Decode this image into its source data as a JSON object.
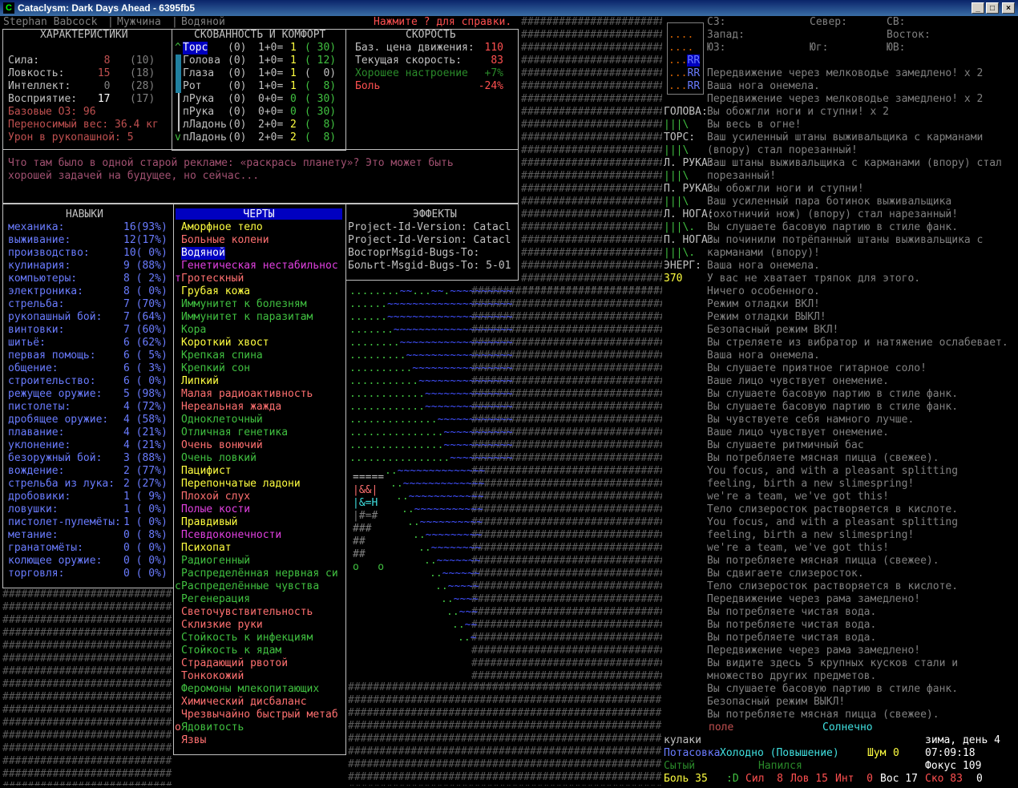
{
  "window": {
    "title": "Cataclysm: Dark Days Ahead - 6395fb5",
    "app_icon": "C",
    "min": "_",
    "max": "□",
    "close": "×"
  },
  "header": {
    "name": "Stephan Babcock",
    "sep1": "|",
    "gender": "Мужчина",
    "sep2": "|",
    "profession": "Водяной",
    "help": "Нажмите ? для справки."
  },
  "stats": {
    "title": "ХАРАКТЕРИСТИКИ",
    "rows": [
      {
        "label": "Сила:",
        "val": "8",
        "base": "(10)"
      },
      {
        "label": "Ловкость:",
        "val": "15",
        "base": "(18)"
      },
      {
        "label": "Интеллект:",
        "val": "0",
        "base": "(28)"
      },
      {
        "label": "Восприятие:",
        "val": "17",
        "base": "(17)"
      }
    ],
    "base_hp": "Базовые ОЗ: 96",
    "carry": "Переносимый вес: 36.4 кг",
    "unarmed": "Урон в рукопашной: 5"
  },
  "encumbrance": {
    "title": "СКОВАННОСТЬ И КОМФОРТ",
    "up_arrow": "^",
    "down_arrow": "v",
    "rows": [
      {
        "part": "Торс",
        "a": "(0)",
        "calc": "1+0=",
        "val": "1",
        "warm": "( 30)"
      },
      {
        "part": "Голова",
        "a": "(0)",
        "calc": "1+0=",
        "val": "1",
        "warm": "( 12)"
      },
      {
        "part": "Глаза",
        "a": "(0)",
        "calc": "1+0=",
        "val": "1",
        "warm": "(  0)"
      },
      {
        "part": "Рот",
        "a": "(0)",
        "calc": "1+0=",
        "val": "1",
        "warm": "(  8)"
      },
      {
        "part": "лРука",
        "a": "(0)",
        "calc": "0+0=",
        "val": "0",
        "warm": "( 30)"
      },
      {
        "part": "пРука",
        "a": "(0)",
        "calc": "0+0=",
        "val": "0",
        "warm": "( 30)"
      },
      {
        "part": "лЛадонь",
        "a": "(0)",
        "calc": "2+0=",
        "val": "2",
        "warm": "(  8)"
      },
      {
        "part": "пЛадонь",
        "a": "(0)",
        "calc": "2+0=",
        "val": "2",
        "warm": "(  8)"
      }
    ]
  },
  "speed": {
    "title": "СКОРОСТЬ",
    "rows": [
      {
        "label": "Баз. цена движения:",
        "val": "110"
      },
      {
        "label": "Текущая скорость:",
        "val": "83"
      },
      {
        "label": "Хорошее настроение",
        "val": "+7%"
      },
      {
        "label": "Боль",
        "val": "-24%"
      }
    ]
  },
  "description": {
    "line1": "Что там было в одной старой рекламе: «раскрась планету»? Это может быть",
    "line2": "хорошей задачей на будущее, но сейчас..."
  },
  "skills": {
    "title": "НАВЫКИ",
    "rows": [
      {
        "n": "механика:",
        "v": "16(93%)"
      },
      {
        "n": "выживание:",
        "v": "12(17%)"
      },
      {
        "n": "производство:",
        "v": "10( 0%)"
      },
      {
        "n": "кулинария:",
        "v": "9 (88%)"
      },
      {
        "n": "компьютеры:",
        "v": "8 ( 2%)"
      },
      {
        "n": "электроника:",
        "v": "8 ( 0%)"
      },
      {
        "n": "стрельба:",
        "v": "7 (70%)"
      },
      {
        "n": "рукопашный бой:",
        "v": "7 (64%)"
      },
      {
        "n": "винтовки:",
        "v": "7 (60%)"
      },
      {
        "n": "шитьё:",
        "v": "6 (62%)"
      },
      {
        "n": "первая помощь:",
        "v": "6 ( 5%)"
      },
      {
        "n": "общение:",
        "v": "6 ( 3%)"
      },
      {
        "n": "строительство:",
        "v": "6 ( 0%)"
      },
      {
        "n": "режущее оружие:",
        "v": "5 (98%)"
      },
      {
        "n": "пистолеты:",
        "v": "4 (72%)"
      },
      {
        "n": "дробящее оружие:",
        "v": "4 (58%)"
      },
      {
        "n": "плавание:",
        "v": "4 (21%)"
      },
      {
        "n": "уклонение:",
        "v": "4 (21%)"
      },
      {
        "n": "безоружный бой:",
        "v": "3 (88%)"
      },
      {
        "n": "вождение:",
        "v": "2 (77%)"
      },
      {
        "n": "стрельба из лука:",
        "v": "2 (27%)"
      },
      {
        "n": "дробовики:",
        "v": "1 ( 9%)"
      },
      {
        "n": "ловушки:",
        "v": "1 ( 0%)"
      },
      {
        "n": "пистолет-пулемёты:",
        "v": "1 ( 0%)"
      },
      {
        "n": "метание:",
        "v": "0 ( 8%)"
      },
      {
        "n": "гранатомёты:",
        "v": "0 ( 0%)"
      },
      {
        "n": "колющее оружие:",
        "v": "0 ( 0%)"
      },
      {
        "n": "торговля:",
        "v": "0 ( 0%)"
      }
    ]
  },
  "traits": {
    "title": "ЧЕРТЫ",
    "markers": {
      "t": "т",
      "c": "c",
      "o": "o"
    },
    "rows": [
      {
        "t": "Аморфное тело",
        "c": "#ffff40"
      },
      {
        "t": "Больные колени",
        "c": "#ff7070"
      },
      {
        "t": "Водяной",
        "c": "#ffffff"
      },
      {
        "t": "Генетическая нестабильнос",
        "c": "#e040e0"
      },
      {
        "t": "Гротескный",
        "c": "#ff7070"
      },
      {
        "t": "Грубая кожа",
        "c": "#ffff40"
      },
      {
        "t": "Иммунитет к болезням",
        "c": "#40c040"
      },
      {
        "t": "Иммунитет к паразитам",
        "c": "#40c040"
      },
      {
        "t": "Кора",
        "c": "#40c040"
      },
      {
        "t": "Короткий хвост",
        "c": "#ffff40"
      },
      {
        "t": "Крепкая спина",
        "c": "#40c040"
      },
      {
        "t": "Крепкий сон",
        "c": "#40c040"
      },
      {
        "t": "Липкий",
        "c": "#ffff40"
      },
      {
        "t": "Малая радиоактивность",
        "c": "#ff7070"
      },
      {
        "t": "Нереальная жажда",
        "c": "#ff7070"
      },
      {
        "t": "Одноклеточный",
        "c": "#40c040"
      },
      {
        "t": "Отличная генетика",
        "c": "#40c040"
      },
      {
        "t": "Очень вонючий",
        "c": "#ff7070"
      },
      {
        "t": "Очень ловкий",
        "c": "#40c040"
      },
      {
        "t": "Пацифист",
        "c": "#ffff40"
      },
      {
        "t": "Перепончатые ладони",
        "c": "#ffff40"
      },
      {
        "t": "Плохой слух",
        "c": "#ff7070"
      },
      {
        "t": "Полые кости",
        "c": "#e040e0"
      },
      {
        "t": "Правдивый",
        "c": "#ffff40"
      },
      {
        "t": "Псевдоконечности",
        "c": "#e040e0"
      },
      {
        "t": "Психопат",
        "c": "#ffff40"
      },
      {
        "t": "Радиогенный",
        "c": "#40c040"
      },
      {
        "t": "Распределённая нервная си",
        "c": "#40c040"
      },
      {
        "t": "Распределённые чувства",
        "c": "#40c040"
      },
      {
        "t": "Регенерация",
        "c": "#40c040"
      },
      {
        "t": "Светочувствительность",
        "c": "#ff7070"
      },
      {
        "t": "Склизкие руки",
        "c": "#ff7070"
      },
      {
        "t": "Стойкость к инфекциям",
        "c": "#40c040"
      },
      {
        "t": "Стойкость к ядам",
        "c": "#40c040"
      },
      {
        "t": "Страдающий рвотой",
        "c": "#ff7070"
      },
      {
        "t": "Тонкокожий",
        "c": "#ff7070"
      },
      {
        "t": "Феромоны млекопитающих",
        "c": "#40c040"
      },
      {
        "t": "Химический дисбаланс",
        "c": "#ff7070"
      },
      {
        "t": "Чрезвычайно быстрый метаб",
        "c": "#ff7070"
      },
      {
        "t": "Ядовитость",
        "c": "#40c040"
      },
      {
        "t": "Язвы",
        "c": "#ff7070"
      }
    ]
  },
  "effects": {
    "title": "ЭФФЕКТЫ",
    "rows": [
      "Project-Id-Version: Catacl",
      "Project-Id-Version: Catacl",
      "ВосторгMsgid-Bugs-To:",
      "Больrt-Msgid-Bugs-To: 5-01"
    ]
  },
  "compass": {
    "rows": [
      {
        "a": "СЗ:",
        "b": "Север:",
        "c": "СВ:"
      },
      {
        "a": "Запад:",
        "b": "",
        "c": "Восток:"
      },
      {
        "a": "ЮЗ:",
        "b": "Юг:",
        "c": "ЮВ:"
      }
    ]
  },
  "body_status": [
    {
      "label": "ГОЛОВА:",
      "bar": "|||\\"
    },
    {
      "label": "ТОРС:",
      "bar": "|||\\"
    },
    {
      "label": "Л. РУКА:",
      "bar": "|||\\"
    },
    {
      "label": "П. РУКА:",
      "bar": "|||\\"
    },
    {
      "label": "Л. НОГА:",
      "bar": "|||\\."
    },
    {
      "label": "П. НОГА:",
      "bar": "|||\\."
    }
  ],
  "energy": {
    "label": "ЭНЕРГ:",
    "val": "370"
  },
  "log": [
    "Передвижение через мелководье замедлено! x 2",
    "Ваша нога онемела.",
    "Передвижение через мелководье замедлено! x 2",
    "Вы обожгли ноги и ступни! x 2",
    "Вы весь в огне!",
    "Ваш усиленный штаны выживальщика с карманами",
    "(впору) стал порезанный!",
    "Ваш штаны выживальщика с карманами (впору) стал",
    "порезанный!",
    "Вы обожгли ноги и ступни!",
    "Ваш усиленный пара ботинок выживальщика",
    "(охотничий нож) (впору) стал нарезанный!",
    "Вы слушаете басовую партию в стиле фанк.",
    "Вы починили потрёпанный штаны выживальщика с",
    "карманами (впору)!",
    "Ваша нога онемела.",
    "У вас не хватает тряпок для этого.",
    "Ничего особенного.",
    "Режим отладки ВКЛ!",
    "Режим отладки ВЫКЛ!",
    "Безопасный режим ВКЛ!",
    "Вы стреляете из вибратор и натяжение ослабевает.",
    "Ваша нога онемела.",
    "Вы слушаете приятное гитарное соло!",
    "Ваше лицо чувствует онемение.",
    "Вы слушаете басовую партию в стиле фанк.",
    "Вы слушаете басовую партию в стиле фанк.",
    "Вы чувствуете себя намного лучше.",
    "Ваше лицо чувствует онемение.",
    "Вы слушаете ритмичный бас",
    "Вы потребляете мясная пицца (свежее).",
    "You focus, and with a pleasant splitting",
    "feeling, birth a new slimespring!",
    "we're a team, we've got this!",
    "Тело слизеросток растворяется в кислоте.",
    "You focus, and with a pleasant splitting",
    "feeling, birth a new slimespring!",
    "we're a team, we've got this!",
    "Вы потребляете мясная пицца (свежее).",
    "Вы сдвигаете слизеросток.",
    "Тело слизеросток растворяется в кислоте.",
    "Передвижение через рама замедлено!",
    "Вы потребляете чистая вода.",
    "Вы потребляете чистая вода.",
    "Вы потребляете чистая вода.",
    "Передвижение через рама замедлено!",
    "Вы видите здесь 5 крупных кусков стали и",
    "множество других предметов.",
    "Вы слушаете басовую партию в стиле фанк.",
    "Безопасный режим ВЫКЛ!",
    "Вы потребляете мясная пицца (свежее)."
  ],
  "bottom": {
    "terrain": "поле",
    "light": "Солнечно",
    "weapon": "кулаки",
    "style": "Потасовка",
    "temp": "Холодно (Повышение)",
    "noise_label": "Шум",
    "noise": "0",
    "date": "зима, день 4",
    "time": "07:09:18",
    "focus": "Фокус 109",
    "hunger": "Сытый",
    "thirst": "Напился",
    "pain": "Боль 35",
    "mood": ":D",
    "str": "Сил  8",
    "dex": "Лов 15",
    "int": "Инт  0",
    "per": "Вос 17",
    "spd": "Ско 83",
    "extra": "0"
  },
  "minimap": {
    "rows": [
      "....",
      "....",
      "...RR",
      "...RR",
      "...RR"
    ]
  },
  "map": {
    "hash_char": "#",
    "rows": [
      "........~~...~~.~~~~~~~~~~",
      "......~~~~~~~~~~~~~~~~~~~~",
      "......~~~~~~~~~~~~~~~~~~~~",
      ".......~~~~~~~~~~~~~~~~~~~",
      "........~~~~~~~~~~~~~~~~~~",
      ".........~~~~~~~~~~~~~~~~~",
      "..........~~~~~~~~~~~~~~~~",
      "...........~~~~~~~~~~~~~~~",
      "............~~~~~~~~~~~~~~",
      "............~~~~~~~~~~~~~~",
      "..............~~~~~~~~~~~~",
      "...............~~~~~~~~~~~",
      "...............~~~~~~~~~~~",
      "................~~~~~~~~~~"
    ],
    "building": [
      "=====",
      "|&&|",
      "|&=H",
      "|#=#",
      "###",
      "##",
      "##",
      "o   o"
    ]
  }
}
